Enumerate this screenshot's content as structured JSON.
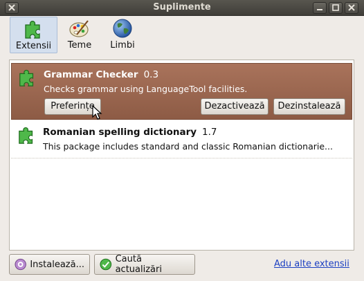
{
  "window": {
    "title": "Suplimente"
  },
  "tabs": [
    {
      "label": "Extensii",
      "icon": "puzzle-icon",
      "active": true
    },
    {
      "label": "Teme",
      "icon": "palette-icon",
      "active": false
    },
    {
      "label": "Limbi",
      "icon": "globe-icon",
      "active": false
    }
  ],
  "extensions": [
    {
      "name": "Grammar Checker",
      "version": "0.3",
      "description": "Checks grammar using LanguageTool facilities.",
      "selected": true,
      "buttons": {
        "preferences": "Preferințe",
        "disable": "Dezactivează",
        "uninstall": "Dezinstalează"
      }
    },
    {
      "name": "Romanian spelling dictionary",
      "version": "1.7",
      "description": "This package includes standard and classic Romanian dictionarie...",
      "selected": false
    }
  ],
  "footer": {
    "install_label": "Instalează...",
    "check_updates_label": "Caută actualizări",
    "more_link": "Adu alte extensii"
  },
  "colors": {
    "selection": "#9a664f",
    "link": "#1b3fc2",
    "titlebar": "#4c4a45"
  }
}
